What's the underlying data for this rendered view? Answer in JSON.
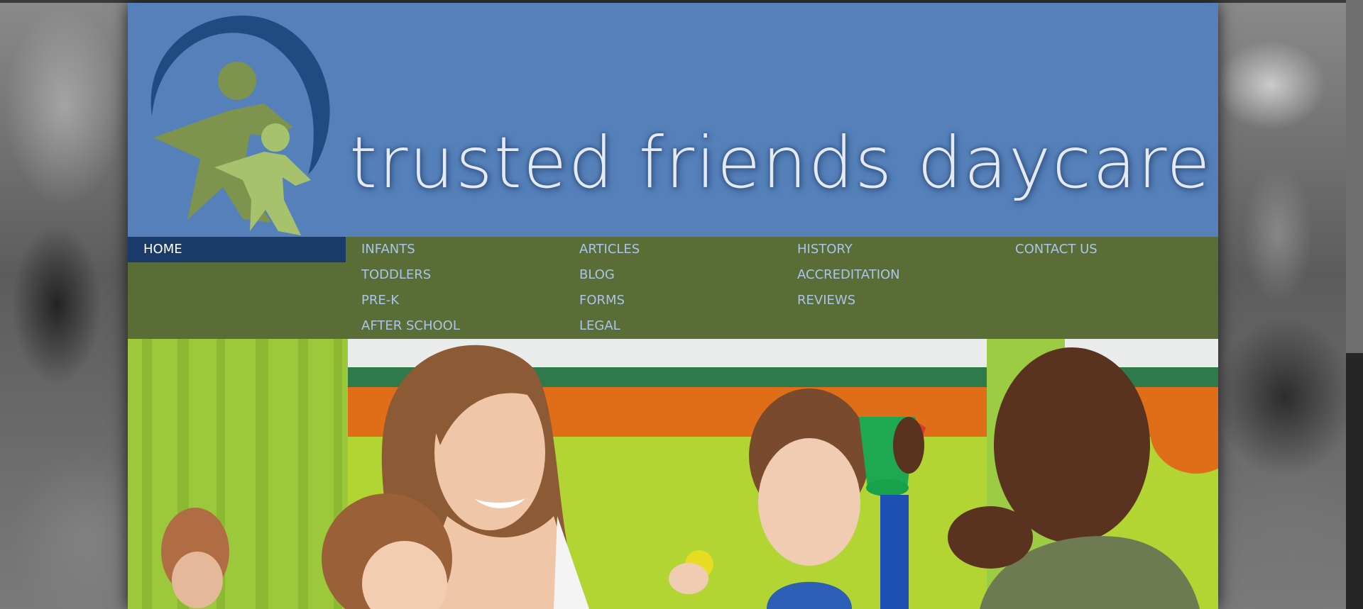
{
  "site": {
    "title": "trusted friends daycare",
    "logo_icon": "family-logo-icon",
    "colors": {
      "header_blue": "#5580b9",
      "nav_green": "#5a6d36",
      "nav_active": "#1a3a69",
      "nav_link": "#aac5ea"
    }
  },
  "nav": {
    "home": "HOME",
    "columns": [
      [
        "INFANTS",
        "TODDLERS",
        "PRE-K",
        "AFTER SCHOOL"
      ],
      [
        "ARTICLES",
        "BLOG",
        "FORMS",
        "LEGAL"
      ],
      [
        "HISTORY",
        "ACCREDITATION",
        "REVIEWS"
      ],
      [
        "CONTACT US"
      ]
    ]
  },
  "hero": {
    "image": "teacher-with-children-photo"
  },
  "background": {
    "image": "grayscale-kids-background-photo"
  }
}
